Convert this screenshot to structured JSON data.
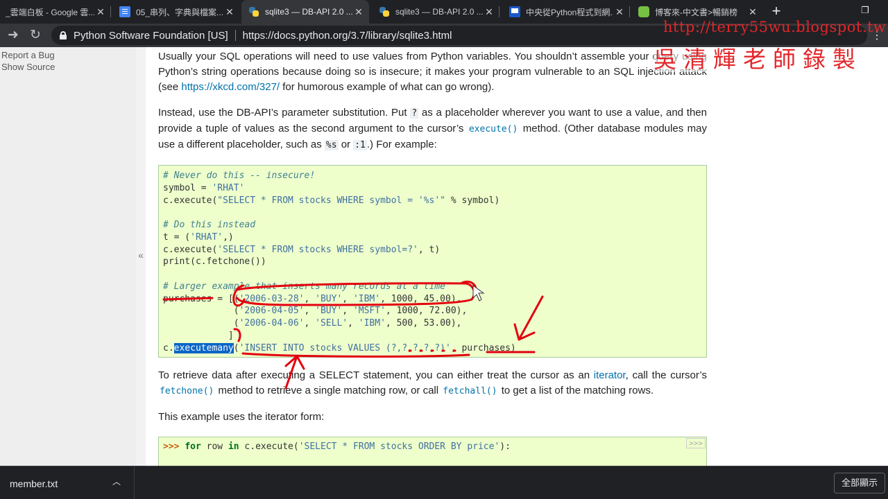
{
  "tabs": [
    {
      "title": "_雲端白板 - Google 雲...",
      "icon": "google-drive-icon"
    },
    {
      "title": "05_串列、字典與檔案...",
      "icon": "google-docs-icon"
    },
    {
      "title": "sqlite3 — DB-API 2.0 ...",
      "icon": "python-icon",
      "active": true
    },
    {
      "title": "sqlite3 — DB-API 2.0 ...",
      "icon": "python-icon"
    },
    {
      "title": "中央從Python程式到網...",
      "icon": "blog-icon"
    },
    {
      "title": "博客來-中文書>暢銷榜",
      "icon": "line-icon"
    }
  ],
  "toolbar": {
    "site_org": "Python Software Foundation [US]",
    "url": "https://docs.python.org/3.7/library/sqlite3.html"
  },
  "watermark": {
    "blog_url": "http://terry55wu.blogspot.tw",
    "author": "吳清輝老師錄製"
  },
  "sidebar": {
    "links": [
      "Report a Bug",
      "Show Source"
    ],
    "collapse": "«"
  },
  "content": {
    "p1_text1": "Usually your SQL operations will need to use values from Python variables. You shouldn’t assemble your query using Python’s string operations because doing so is insecure; it makes your program vulnerable to an SQL injection attack (see ",
    "p1_link": "https://xkcd.com/327/",
    "p1_text2": " for humorous example of what can go wrong).",
    "p2_text1": "Instead, use the DB-API’s parameter substitution. Put ",
    "p2_code1": "?",
    "p2_text2": " as a placeholder wherever you want to use a value, and then provide a tuple of values as the second argument to the cursor’s ",
    "p2_code2": "execute()",
    "p2_text3": " method. (Other database modules may use a different placeholder, such as ",
    "p2_code3": "%s",
    "p2_text4": " or ",
    "p2_code4": ":1",
    "p2_text5": ".) For example:",
    "code1": {
      "l1": "# Never do this -- insecure!",
      "l2a": "symbol = ",
      "l2b": "'RHAT'",
      "l3a": "c.execute(",
      "l3b": "\"SELECT * FROM stocks WHERE symbol = '%s'\"",
      "l3c": " % symbol)",
      "l5": "# Do this instead",
      "l6a": "t = (",
      "l6b": "'RHAT'",
      "l6c": ",)",
      "l7a": "c.execute(",
      "l7b": "'SELECT * FROM stocks WHERE symbol=?'",
      "l7c": ", t)",
      "l8": "print(c.fetchone())",
      "l10": "# Larger example that inserts many records at a time",
      "l11a": "purchases = [(",
      "l11b": "'2006-03-28'",
      "l11c": ", ",
      "l11d": "'BUY'",
      "l11e": ", ",
      "l11f": "'IBM'",
      "l11g": ", 1000, 45.00),",
      "l12a": "             (",
      "l12b": "'2006-04-05'",
      "l12c": ", ",
      "l12d": "'BUY'",
      "l12e": ", ",
      "l12f": "'MSFT'",
      "l12g": ", 1000, 72.00),",
      "l13a": "             (",
      "l13b": "'2006-04-06'",
      "l13c": ", ",
      "l13d": "'SELL'",
      "l13e": ", ",
      "l13f": "'IBM'",
      "l13g": ", 500, 53.00),",
      "l14": "            ]",
      "l15a": "c.",
      "l15b": "executemany",
      "l15c": "(",
      "l15d": "'INSERT INTO stocks VALUES (?,?,?,?,?)'",
      "l15e": ", purchases)"
    },
    "p3_text1": "To retrieve data after executing a SELECT statement, you can either treat the cursor as an ",
    "p3_link": "iterator",
    "p3_text2": ", call the cursor’s ",
    "p3_code1": "fetchone()",
    "p3_text3": " method to retrieve a single matching row, or call ",
    "p3_code2": "fetchall()",
    "p3_text4": " to get a list of the matching rows.",
    "p4": "This example uses the iterator form:",
    "code2": {
      "prompt": ">>>",
      "kw1": "for",
      "t1": " row ",
      "kw2": "in",
      "t2": " c.execute(",
      "str": "'SELECT * FROM stocks ORDER BY price'",
      "t3": "):",
      "copy": ">>>"
    }
  },
  "downloads": {
    "file": "member.txt",
    "chevron": "︿",
    "show_all": "全部顯示"
  },
  "colors": {
    "annotation": "#e3000f",
    "code_bg": "#eeffcc",
    "link": "#0072aa"
  }
}
